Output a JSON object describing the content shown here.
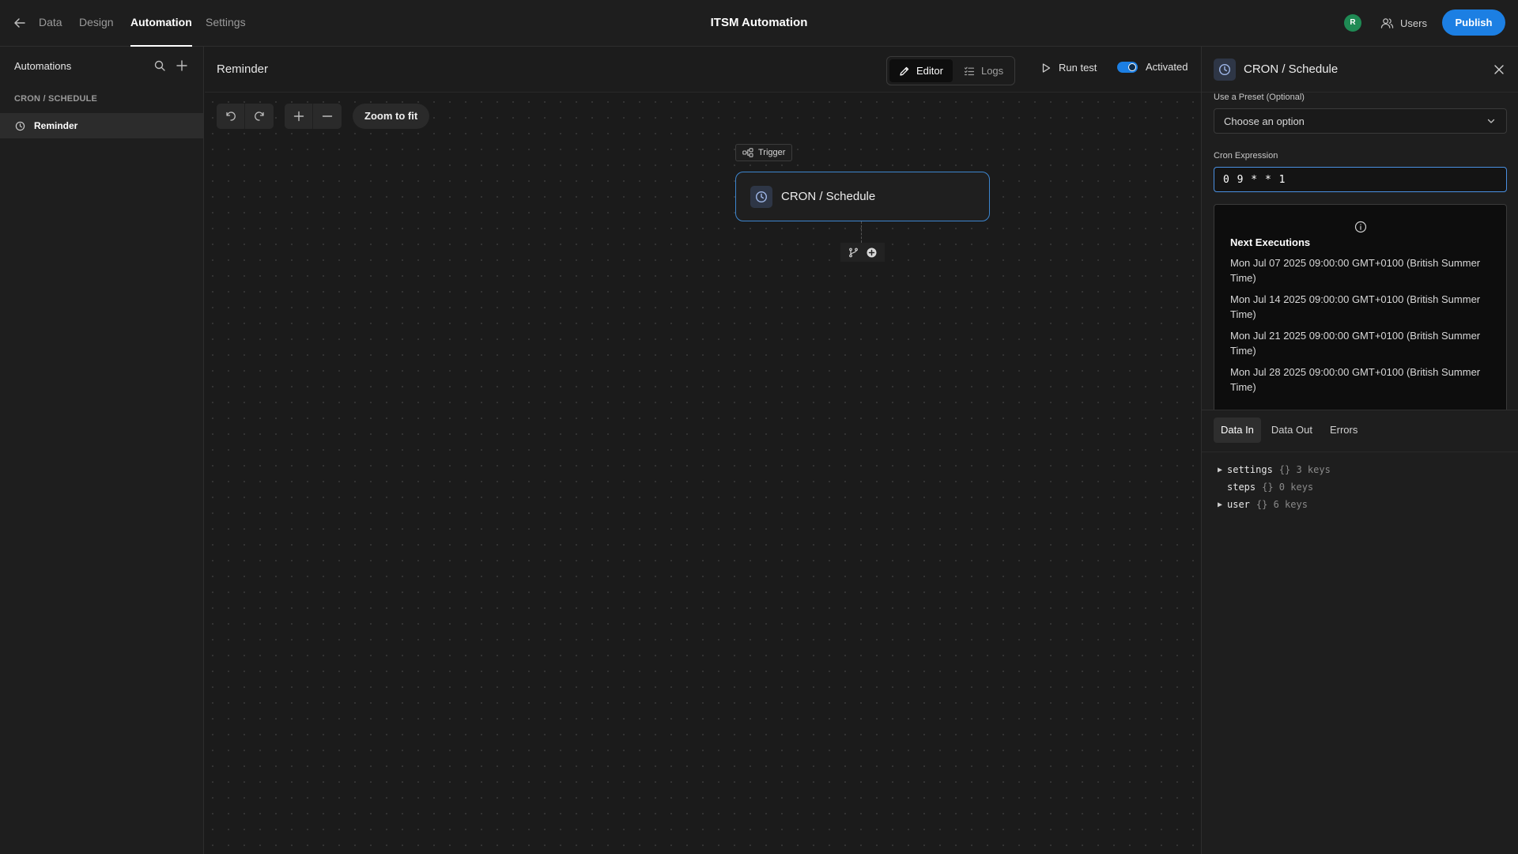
{
  "topbar": {
    "tabs": [
      {
        "label": "Data"
      },
      {
        "label": "Design"
      },
      {
        "label": "Automation"
      },
      {
        "label": "Settings"
      }
    ],
    "title": "ITSM Automation",
    "avatar_initial": "R",
    "users_label": "Users",
    "publish_label": "Publish"
  },
  "sidebar": {
    "title": "Automations",
    "section": "CRON / SCHEDULE",
    "items": [
      {
        "label": "Reminder",
        "icon": "clock-icon"
      }
    ]
  },
  "canvas": {
    "automation_name": "Reminder",
    "editor_label": "Editor",
    "logs_label": "Logs",
    "run_test_label": "Run test",
    "activated_label": "Activated",
    "activated": true,
    "zoom_to_fit_label": "Zoom to fit",
    "trigger_label": "Trigger",
    "node_title": "CRON / Schedule"
  },
  "panel": {
    "title": "CRON / Schedule",
    "preset_label": "Use a Preset (Optional)",
    "preset_value": "Choose an option",
    "cron_label": "Cron Expression",
    "cron_value": "0 9 * * 1",
    "next_exec_title": "Next Executions",
    "executions": [
      "Mon Jul 07 2025 09:00:00 GMT+0100 (British Summer Time)",
      "Mon Jul 14 2025 09:00:00 GMT+0100 (British Summer Time)",
      "Mon Jul 21 2025 09:00:00 GMT+0100 (British Summer Time)",
      "Mon Jul 28 2025 09:00:00 GMT+0100 (British Summer Time)"
    ],
    "tabs": [
      {
        "label": "Data In"
      },
      {
        "label": "Data Out"
      },
      {
        "label": "Errors"
      }
    ],
    "tree": [
      {
        "key": "settings",
        "meta": "{} 3 keys",
        "expandable": true
      },
      {
        "key": "steps",
        "meta": "{} 0 keys",
        "expandable": false
      },
      {
        "key": "user",
        "meta": "{} 6 keys",
        "expandable": true
      }
    ]
  },
  "colors": {
    "accent": "#1c7fe3",
    "background": "#1b1b1b",
    "node_border": "#3d86cf",
    "avatar": "#1f8a54"
  }
}
